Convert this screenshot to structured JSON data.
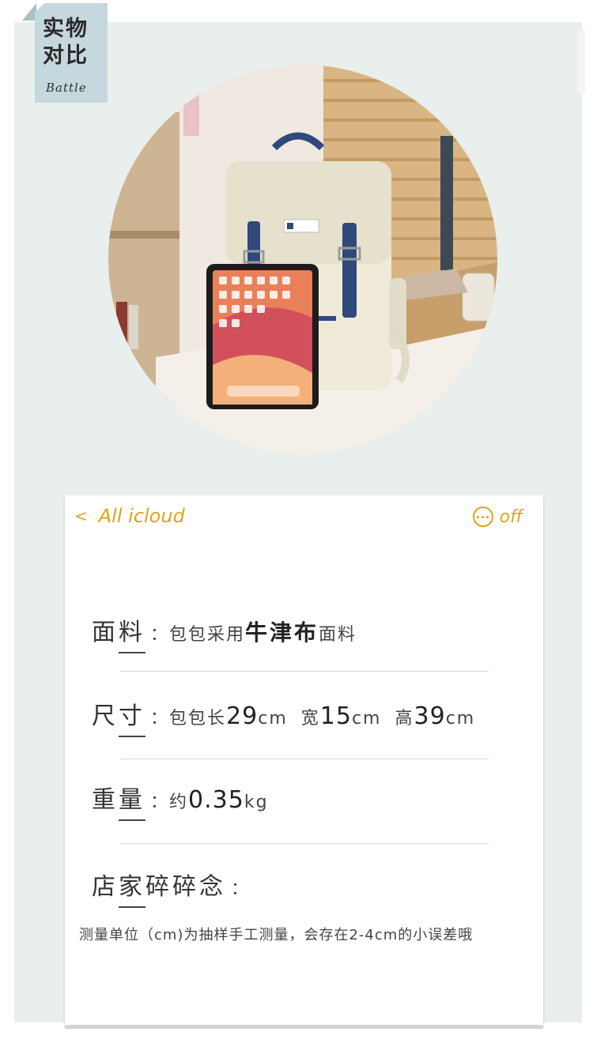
{
  "tag": {
    "line1": "实物",
    "line2": "对比",
    "line3": "Battle"
  },
  "card": {
    "back_label": "All icloud",
    "more_label": "off",
    "material": {
      "label": "面料",
      "colon": "：",
      "pre": "包包采用",
      "bold": "牛津布",
      "post": "面料"
    },
    "size": {
      "label": "尺寸",
      "colon": "：",
      "pre": "包包长",
      "l": "29",
      "cm1": "cm",
      "mid1": "宽",
      "w": "15",
      "cm2": "cm",
      "mid2": "高",
      "h": "39",
      "cm3": "cm"
    },
    "weight": {
      "label": "重量",
      "colon": "：",
      "pre": "约",
      "value": "0.35",
      "unit": "kg"
    },
    "notes": {
      "label": "店家碎碎念",
      "colon": "："
    },
    "note_text": "测量单位（cm)为抽样手工测量，会存在2-4cm的小误差哦"
  },
  "colors": {
    "accent": "#e0a41a",
    "panel": "#e9efec",
    "tag": "#c5d8de"
  }
}
